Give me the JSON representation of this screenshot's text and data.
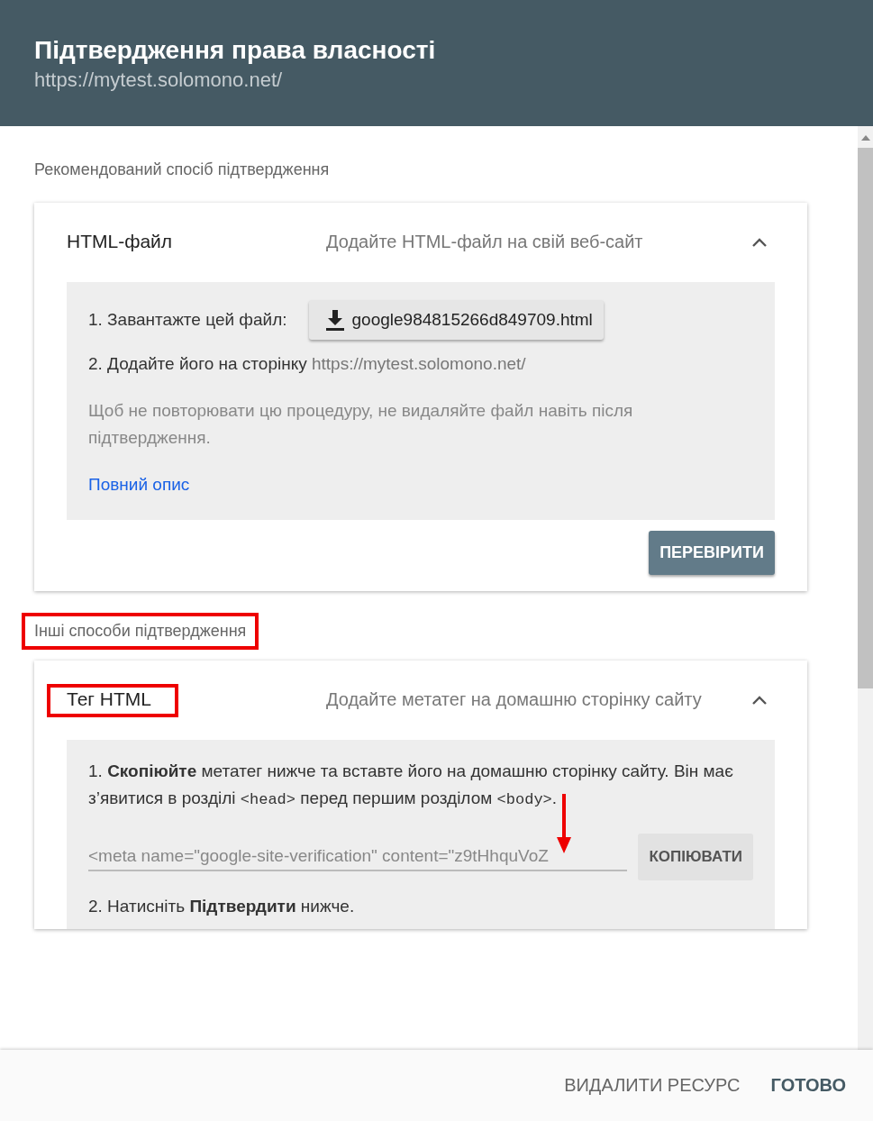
{
  "dialog": {
    "title": "Підтвердження права власності",
    "subtitle": "https://mytest.solomono.net/"
  },
  "recommended": {
    "heading": "Рекомендований спосіб підтвердження",
    "method": {
      "title": "HTML-файл",
      "description": "Додайте HTML-файл на свій веб-сайт",
      "expanded": true,
      "step1_label": "1. Завантажте цей файл:",
      "download_button": "google984815266d849709.html",
      "step2": "2. Додайте його на сторінку",
      "step2_link": "https://mytest.solomono.net/",
      "note": "Щоб не повторювати цю процедуру, не видаляйте файл навіть після підтвердження.",
      "details_link": "Повний опис",
      "verify_button": "ПЕРЕВІРИТИ"
    }
  },
  "other": {
    "heading": "Інші способи підтвердження",
    "highlighted": true,
    "method": {
      "title": "Тег HTML",
      "highlighted": true,
      "description": "Додайте метатег на домашню сторінку сайту",
      "expanded": true,
      "step1": "1. **Скопіюйте** метатег нижче та вставте його на домашню сторінку сайту. Він має з’явитися в розділі <head> перед першим розділом <body>.",
      "meta_tag": "<meta name=\"google-site-verification\" content=\"z9tHhquVoZ",
      "arrow_marker": true,
      "copy_button": "КОПІЮВАТИ",
      "step2": "2. Натисніть **Підтвердити** нижче."
    }
  },
  "footer": {
    "buttons": [
      {
        "label": "ВИДАЛИТИ РЕСУРС",
        "kind": "secondary"
      },
      {
        "label": "ГОТОВО",
        "kind": "primary"
      }
    ]
  }
}
